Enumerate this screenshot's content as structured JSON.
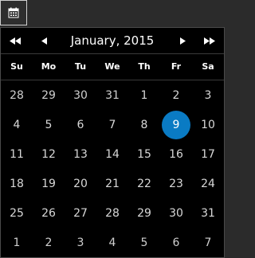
{
  "calendar": {
    "month_title": "January, 2015",
    "weekdays": [
      "Su",
      "Mo",
      "Tu",
      "We",
      "Th",
      "Fr",
      "Sa"
    ],
    "weeks": [
      [
        "28",
        "29",
        "30",
        "31",
        "1",
        "2",
        "3"
      ],
      [
        "4",
        "5",
        "6",
        "7",
        "8",
        "9",
        "10"
      ],
      [
        "11",
        "12",
        "13",
        "14",
        "15",
        "16",
        "17"
      ],
      [
        "18",
        "19",
        "20",
        "21",
        "22",
        "23",
        "24"
      ],
      [
        "25",
        "26",
        "27",
        "28",
        "29",
        "30",
        "31"
      ],
      [
        "1",
        "2",
        "3",
        "4",
        "5",
        "6",
        "7"
      ]
    ],
    "selected_day": "9",
    "accent_color": "#0a7bc4"
  },
  "icons": {
    "calendar_button": "calendar-icon",
    "prev_year": "double-left-arrow-icon",
    "prev_month": "left-arrow-icon",
    "next_month": "right-arrow-icon",
    "next_year": "double-right-arrow-icon"
  }
}
